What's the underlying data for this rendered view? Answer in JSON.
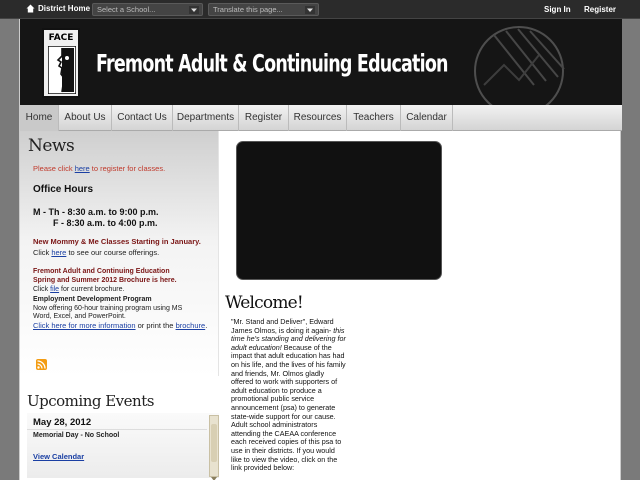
{
  "topbar": {
    "home_label": "District Home",
    "school_select": "Select a School...",
    "translate_select": "Translate this page...",
    "sign_in": "Sign In",
    "register": "Register"
  },
  "header": {
    "logo_text": "FACE",
    "title": "Fremont Adult & Continuing Education"
  },
  "nav": {
    "items": [
      "Home",
      "About Us",
      "Contact Us",
      "Departments",
      "Register",
      "Resources",
      "Teachers",
      "Calendar"
    ],
    "active": "Home"
  },
  "news": {
    "title": "News",
    "register_prefix": "Please click ",
    "register_link": "here",
    "register_suffix": " to register for classes.",
    "office_hours_title": "Office Hours",
    "hours_line1": "M - Th - 8:30 a.m. to 9:00 p.m.",
    "hours_line2": "F - 8:30 a.m. to 4:00 p.m.",
    "mommy_title": "New Mommy & Me Classes Starting in January.",
    "mommy_prefix": "Click ",
    "mommy_link": "here",
    "mommy_suffix": " to see our course offerings.",
    "brochure_title1": "Fremont Adult and Continuing Education",
    "brochure_title2": "Spring and Summer 2012 Brochure is here.",
    "brochure_prefix": "Click ",
    "brochure_link": "file",
    "brochure_suffix": " for current brochure.",
    "edd_title": "Employment Development Program",
    "edd_line1": "Now offering 60-hour training program using MS",
    "edd_line2": "Word, Excel, and PowerPoint.",
    "edd_link": "Click here for more information",
    "edd_mid": " or print the ",
    "edd_link2": "brochure",
    "edd_end": "."
  },
  "events": {
    "title": "Upcoming Events",
    "date": "May 28, 2012",
    "event": "Memorial Day - No School",
    "view_calendar": "View Calendar"
  },
  "main": {
    "welcome_title": "Welcome!",
    "welcome_open": "\"Mr. Stand and Deliver\", Edward James Olmos, is doing it again- ",
    "welcome_italic": "this time he's standing and delivering for adult education!",
    "welcome_body": " Because of the impact that adult education has had on his life, and the lives of his family and friends, Mr. Olmos gladly offered to work with supporters of adult education to produce a promotional public service announcement (psa) to generate state-wide support for our cause.  Adult school administrators attending the CAEAA conference each received copies of this psa to use in their districts.   If you would like to view the video, click on the link provided below:"
  },
  "colors": {
    "header_bg": "#151515",
    "outer_bg": "#7a7a7a",
    "link": "#1a3fa3",
    "accent_red": "#7a1515"
  }
}
